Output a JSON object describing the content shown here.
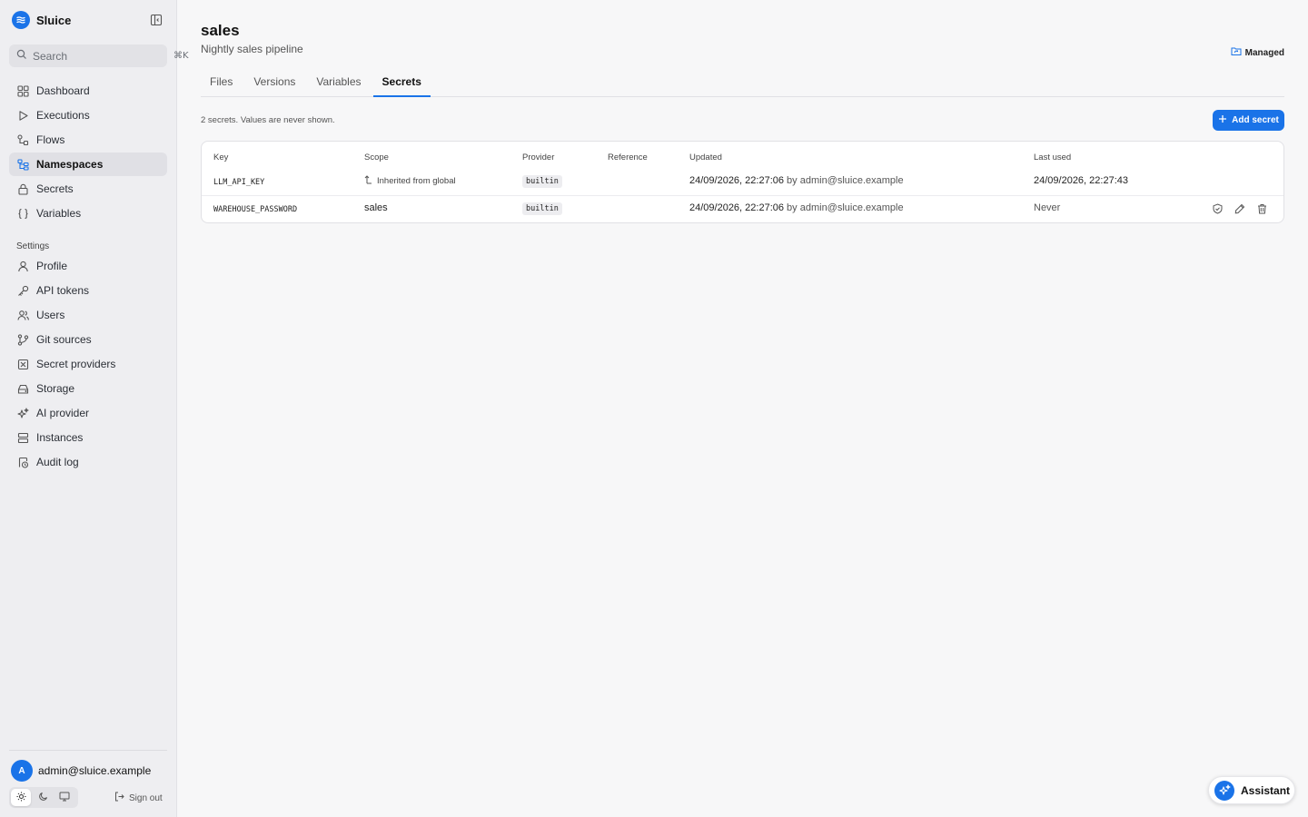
{
  "app": {
    "name": "Sluice"
  },
  "search": {
    "placeholder": "Search",
    "shortcut": "⌘K"
  },
  "sidebar": {
    "items": [
      {
        "label": "Dashboard",
        "icon": "dashboard-icon"
      },
      {
        "label": "Executions",
        "icon": "play-icon"
      },
      {
        "label": "Flows",
        "icon": "flows-icon"
      },
      {
        "label": "Namespaces",
        "icon": "namespaces-icon",
        "active": true
      },
      {
        "label": "Secrets",
        "icon": "lock-icon"
      },
      {
        "label": "Variables",
        "icon": "braces-icon"
      }
    ],
    "settings_label": "Settings",
    "settings_items": [
      {
        "label": "Profile",
        "icon": "user-icon"
      },
      {
        "label": "API tokens",
        "icon": "key-icon"
      },
      {
        "label": "Users",
        "icon": "users-icon"
      },
      {
        "label": "Git sources",
        "icon": "git-branch-icon"
      },
      {
        "label": "Secret providers",
        "icon": "secret-provider-icon"
      },
      {
        "label": "Storage",
        "icon": "storage-icon"
      },
      {
        "label": "AI provider",
        "icon": "sparkles-icon"
      },
      {
        "label": "Instances",
        "icon": "server-icon"
      },
      {
        "label": "Audit log",
        "icon": "audit-icon"
      }
    ],
    "user": {
      "initial": "A",
      "email": "admin@sluice.example"
    },
    "signout_label": "Sign out"
  },
  "page": {
    "title": "sales",
    "subtitle": "Nightly sales pipeline",
    "managed_label": "Managed",
    "tabs": [
      {
        "label": "Files"
      },
      {
        "label": "Versions"
      },
      {
        "label": "Variables"
      },
      {
        "label": "Secrets",
        "active": true
      }
    ],
    "hint": "2 secrets. Values are never shown.",
    "add_button_label": "Add secret"
  },
  "table": {
    "headers": {
      "key": "Key",
      "scope": "Scope",
      "provider": "Provider",
      "reference": "Reference",
      "updated": "Updated",
      "last_used": "Last used"
    },
    "rows": [
      {
        "key": "LLM_API_KEY",
        "scope": "Inherited from global",
        "provider": "builtin",
        "reference": "",
        "updated_time": "24/09/2026, 22:27:06",
        "updated_by": "by admin@sluice.example",
        "last_used": "24/09/2026, 22:27:43"
      },
      {
        "key": "WAREHOUSE_PASSWORD",
        "scope": "sales",
        "provider": "builtin",
        "reference": "",
        "updated_time": "24/09/2026, 22:27:06",
        "updated_by": "by admin@sluice.example",
        "last_used": "Never"
      }
    ]
  },
  "assistant": {
    "label": "Assistant"
  },
  "colors": {
    "accent": "#1a73e8",
    "sidebar_bg": "#eeeef1",
    "page_bg": "#f7f7f8"
  }
}
